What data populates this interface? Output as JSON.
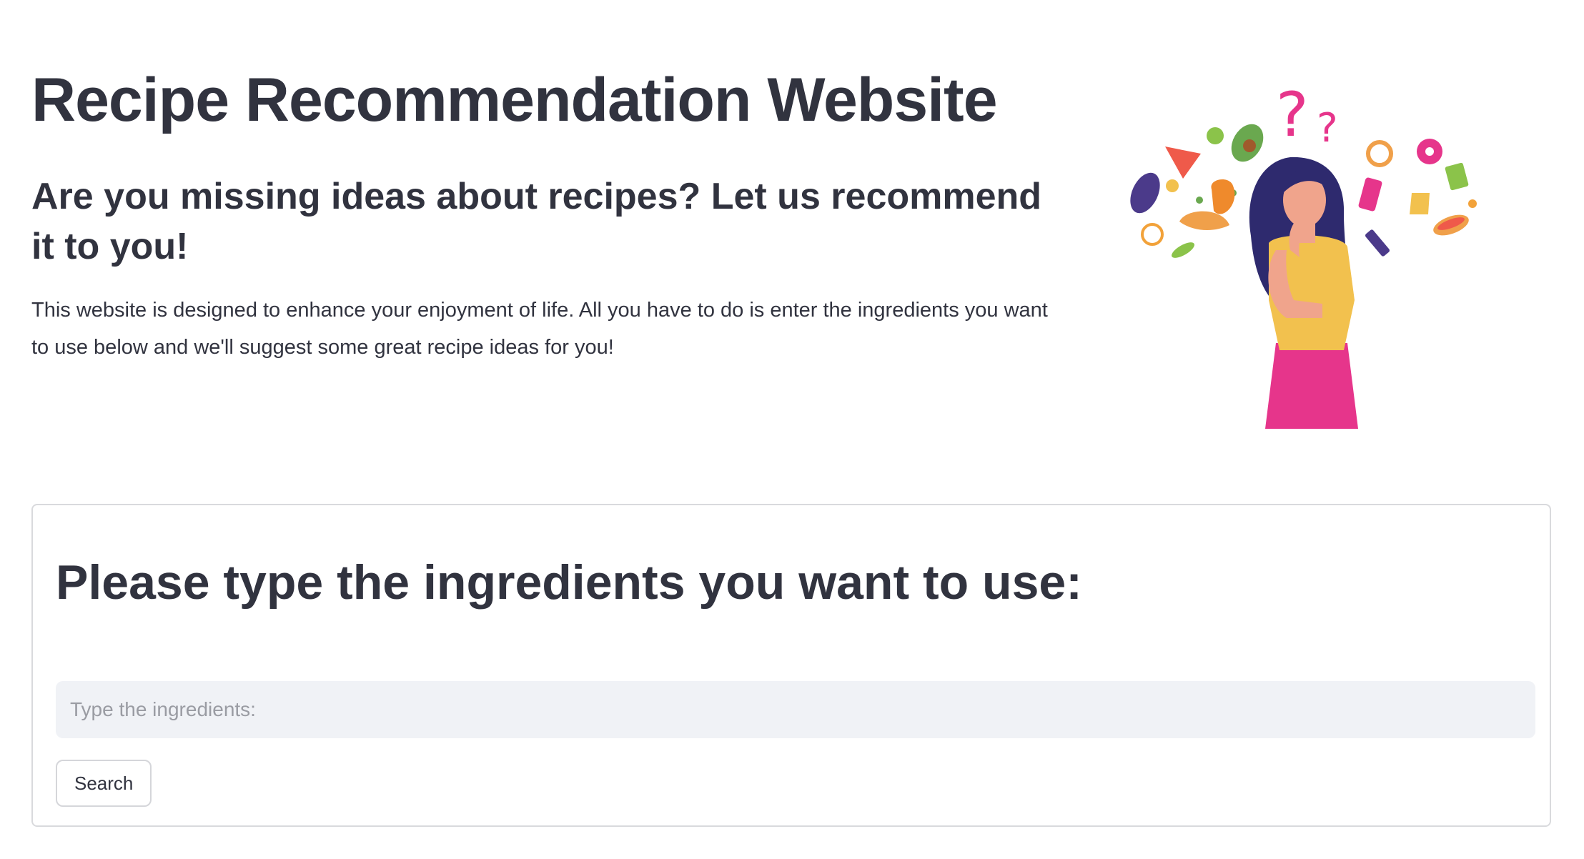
{
  "header": {
    "title": "Recipe Recommendation Website",
    "subtitle": "Are you missing ideas about recipes? Let us recommend it to you!",
    "description": "This website is designed to enhance your enjoyment of life. All you have to do is enter the ingredients you want to use below and we'll suggest some great recipe ideas for you!"
  },
  "illustration": {
    "icon": "woman-thinking-about-food-illustration"
  },
  "form": {
    "heading": "Please type the ingredients you want to use:",
    "input_value": "",
    "input_placeholder": "Type the ingredients:",
    "search_label": "Search"
  },
  "colors": {
    "text": "#31333f",
    "input_bg": "#f0f2f6",
    "border": "#d9dadd",
    "accent_pink": "#e6358b",
    "accent_yellow": "#f2c14e",
    "hair_navy": "#2e2a6e"
  }
}
